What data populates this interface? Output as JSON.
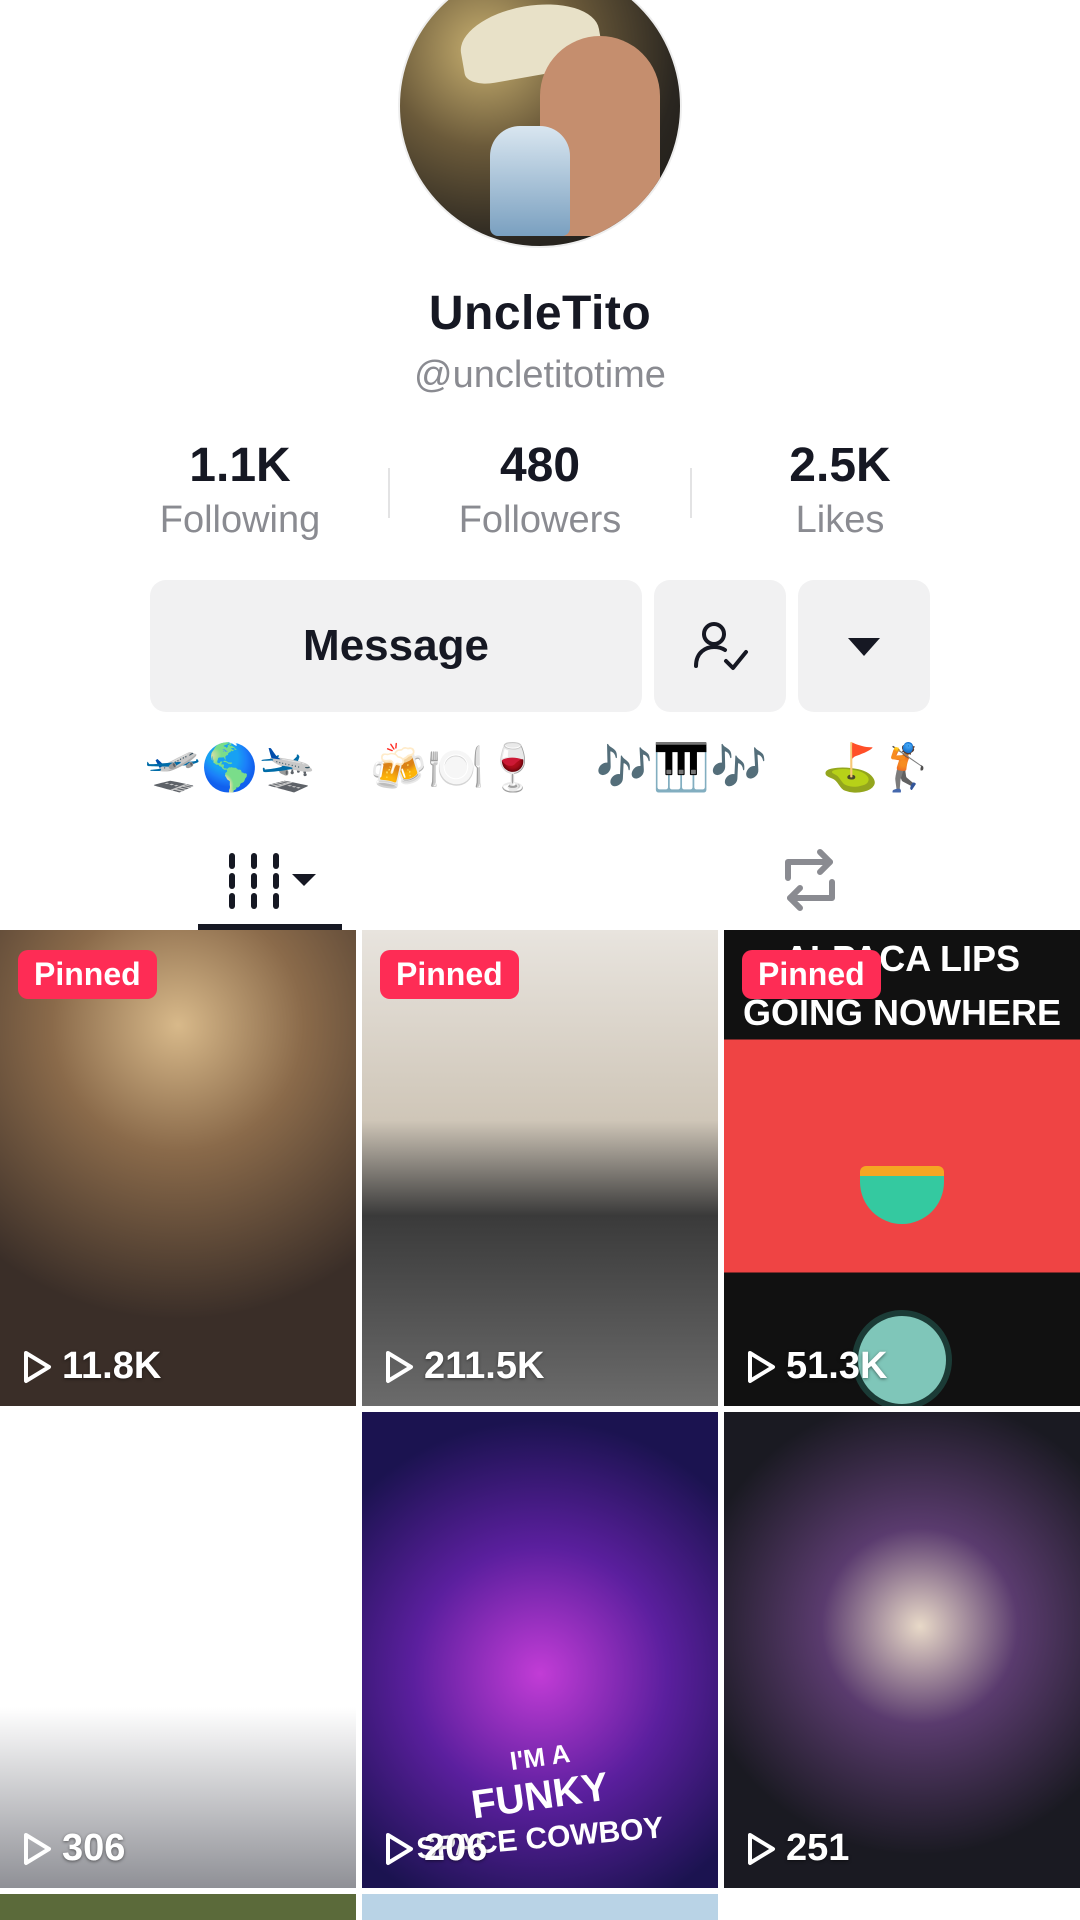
{
  "profile": {
    "display_name": "UncleTito",
    "username": "@uncletitotime"
  },
  "stats": [
    {
      "value": "1.1K",
      "label": "Following"
    },
    {
      "value": "480",
      "label": "Followers"
    },
    {
      "value": "2.5K",
      "label": "Likes"
    }
  ],
  "actions": {
    "message_label": "Message",
    "follow_icon": "user-check-icon",
    "more_icon": "caret-down-icon"
  },
  "bio_emoji": [
    "🛫🌎🛬",
    "🍻🍽️🍷",
    "🎶🎹🎶",
    "⛳🏌️"
  ],
  "tabs": {
    "videos_icon": "grid-icon",
    "reposts_icon": "repost-icon"
  },
  "videos": [
    {
      "views": "11.8K",
      "pinned_label": "Pinned"
    },
    {
      "views": "211.5K",
      "pinned_label": "Pinned"
    },
    {
      "views": "51.3K",
      "pinned_label": "Pinned",
      "caption_top": "ALPACA LIPS",
      "caption_bottom": "GOING NOWHERE"
    },
    {
      "views": "306"
    },
    {
      "views": "206",
      "caption_lines": [
        "I'M A",
        "FUNKY",
        "SPACE COWBOY"
      ]
    },
    {
      "views": "251"
    }
  ],
  "colors": {
    "accent": "#fe2c55",
    "text": "#161823",
    "secondary": "#8a8b91",
    "button_bg": "#f1f1f2"
  }
}
